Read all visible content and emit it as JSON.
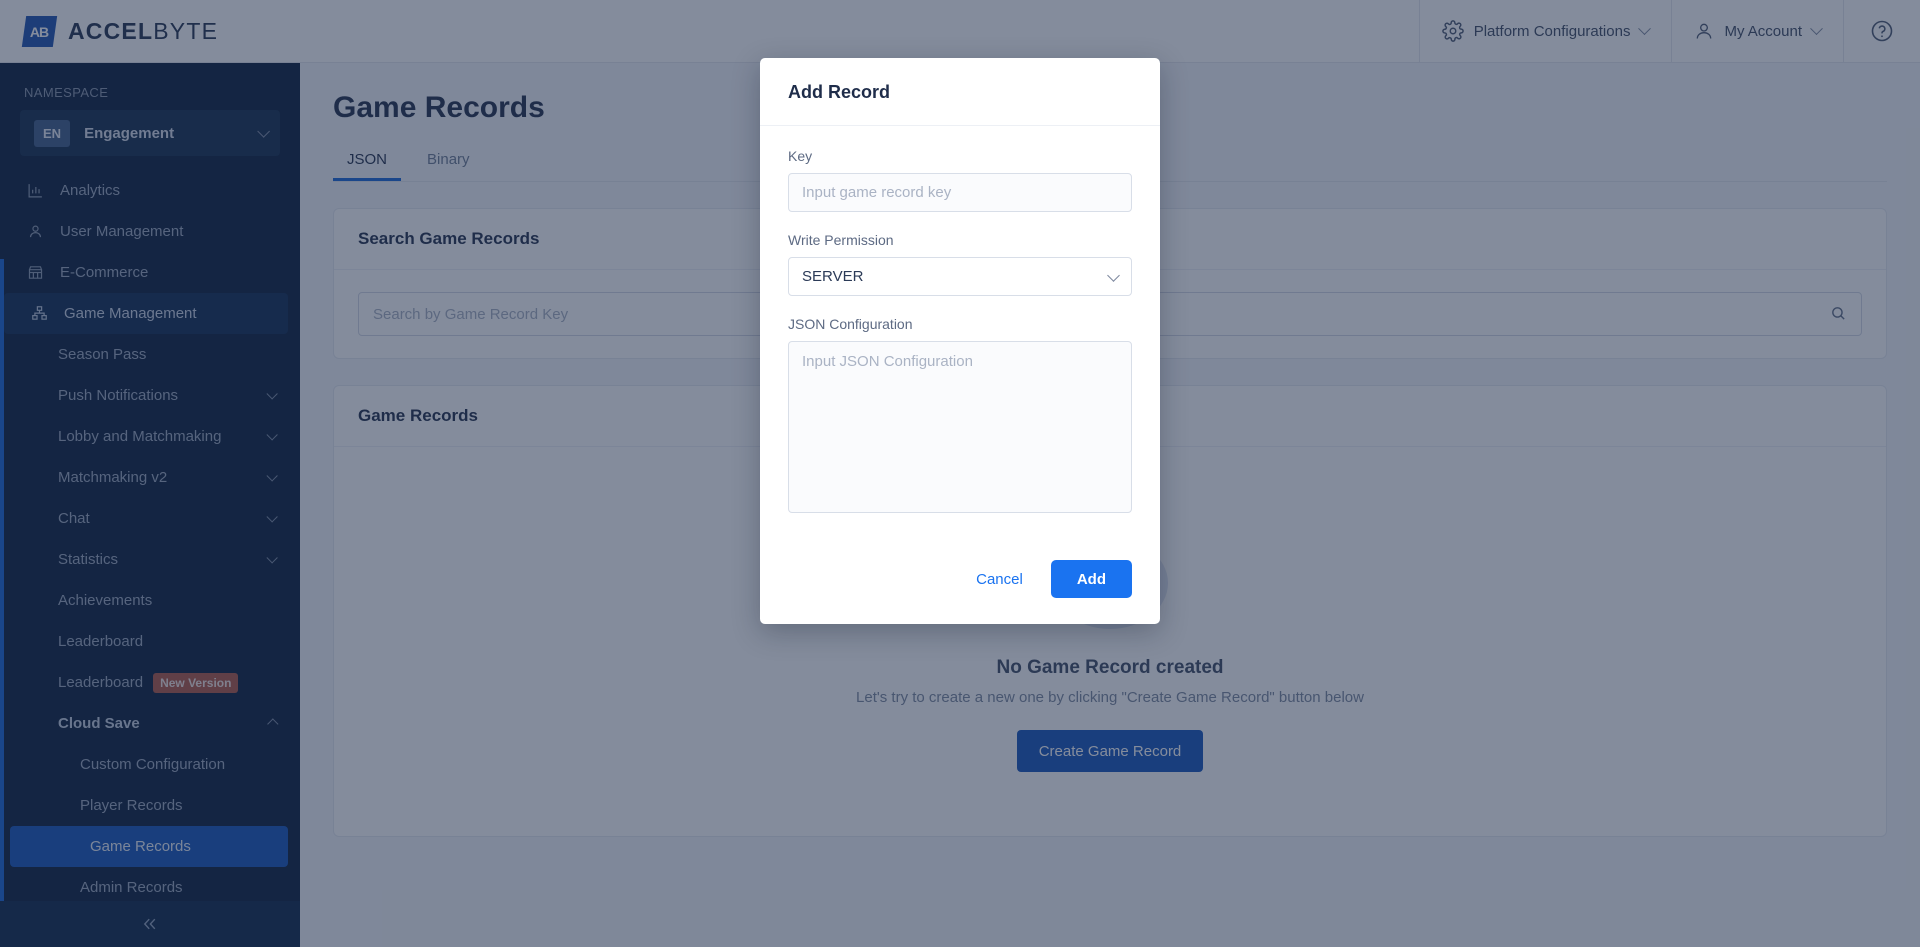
{
  "brand": {
    "mark": "AB",
    "name_bold": "ACCEL",
    "name_light": "BYTE",
    "logo_icon": "accelbyte-logo-icon"
  },
  "topbar": {
    "platform_configurations": "Platform Configurations",
    "my_account": "My Account",
    "gear_icon": "gear-icon",
    "user_icon": "user-icon",
    "help_icon": "help-circle-icon",
    "chevron_icon": "chevron-down-icon"
  },
  "sidebar": {
    "namespace_label": "NAMESPACE",
    "namespace_badge": "EN",
    "namespace_value": "Engagement",
    "collapse_icon": "collapse-double-chevron-left-icon",
    "items": [
      {
        "label": "Analytics",
        "level": "top",
        "icon": "analytics-bar-chart-icon"
      },
      {
        "label": "User Management",
        "level": "top",
        "icon": "user-icon"
      },
      {
        "label": "E-Commerce",
        "level": "top",
        "icon": "store-icon"
      },
      {
        "label": "Game Management",
        "level": "top",
        "icon": "game-management-icon",
        "state": "active-parent"
      },
      {
        "label": "Season Pass",
        "level": "lvl1"
      },
      {
        "label": "Push Notifications",
        "level": "lvl1",
        "chevron": "down"
      },
      {
        "label": "Lobby and Matchmaking",
        "level": "lvl1",
        "chevron": "down"
      },
      {
        "label": "Matchmaking v2",
        "level": "lvl1",
        "chevron": "down"
      },
      {
        "label": "Chat",
        "level": "lvl1",
        "chevron": "down"
      },
      {
        "label": "Statistics",
        "level": "lvl1",
        "chevron": "down"
      },
      {
        "label": "Achievements",
        "level": "lvl1"
      },
      {
        "label": "Leaderboard",
        "level": "lvl1"
      },
      {
        "label": "Leaderboard",
        "level": "lvl1",
        "badge": "New Version"
      },
      {
        "label": "Cloud Save",
        "level": "lvl1",
        "chevron": "up",
        "state": "section"
      },
      {
        "label": "Custom Configuration",
        "level": "lvl2"
      },
      {
        "label": "Player Records",
        "level": "lvl2"
      },
      {
        "label": "Game Records",
        "level": "lvl2",
        "state": "selected"
      },
      {
        "label": "Admin Records",
        "level": "lvl2"
      }
    ]
  },
  "main": {
    "page_title": "Game Records",
    "tabs": [
      {
        "label": "JSON",
        "active": true
      },
      {
        "label": "Binary",
        "active": false
      }
    ],
    "search_card": {
      "title": "Search Game Records",
      "placeholder": "Search by Game Record Key",
      "value": "",
      "search_icon": "search-icon"
    },
    "records_card": {
      "title": "Game Records",
      "empty_illustration_icon": "empty-box-icon",
      "empty_title": "No Game Record created",
      "empty_subtitle": "Let's try to create a new one by clicking \"Create Game Record\" button below",
      "create_button": "Create Game Record"
    }
  },
  "modal": {
    "title": "Add Record",
    "key_label": "Key",
    "key_placeholder": "Input game record key",
    "key_value": "",
    "permission_label": "Write Permission",
    "permission_value": "SERVER",
    "permission_chevron_icon": "chevron-down-icon",
    "json_label": "JSON Configuration",
    "json_placeholder": "Input JSON Configuration",
    "json_value": "",
    "cancel_label": "Cancel",
    "add_label": "Add"
  },
  "colors": {
    "accent_blue": "#1a73f0",
    "sidebar_bg": "#071c3a",
    "selected_item": "#1253ba",
    "badge_new": "#b05443"
  }
}
